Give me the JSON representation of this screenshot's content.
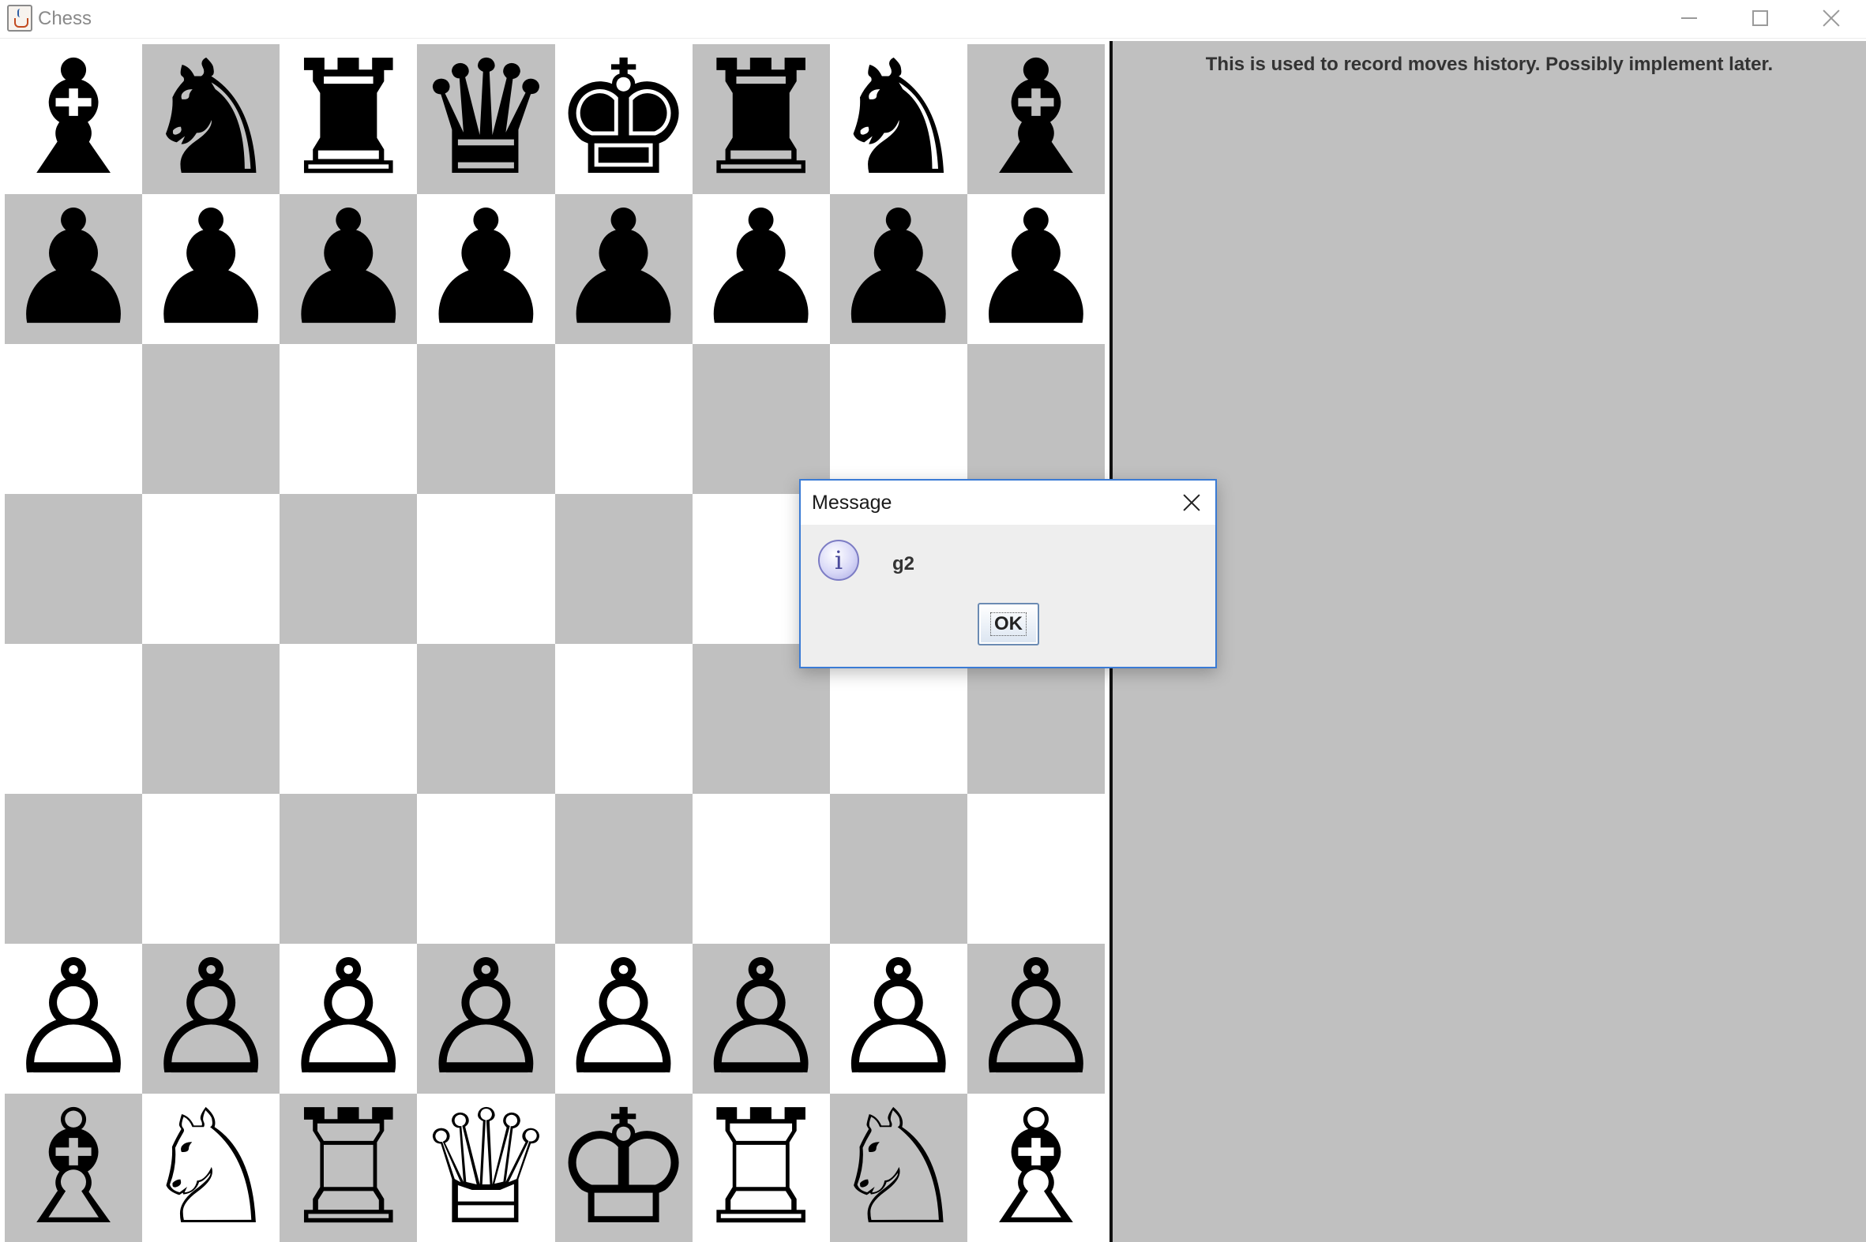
{
  "window": {
    "title": "Chess",
    "app_icon": "java-cup-icon",
    "controls": [
      "minimize-icon",
      "maximize-icon",
      "close-icon"
    ]
  },
  "history_panel": {
    "text": "This is used to record moves history. Possibly implement later.",
    "background": "#c0c0c0"
  },
  "board": {
    "light_color": "#ffffff",
    "dark_color": "#c0c0c0",
    "rows": [
      [
        "black-bishop",
        "black-knight",
        "black-rook",
        "black-queen",
        "black-king",
        "black-rook",
        "black-knight",
        "black-bishop"
      ],
      [
        "black-pawn",
        "black-pawn",
        "black-pawn",
        "black-pawn",
        "black-pawn",
        "black-pawn",
        "black-pawn",
        "black-pawn"
      ],
      [
        "",
        "",
        "",
        "",
        "",
        "",
        "",
        ""
      ],
      [
        "",
        "",
        "",
        "",
        "",
        "",
        "",
        ""
      ],
      [
        "",
        "",
        "",
        "",
        "",
        "",
        "",
        ""
      ],
      [
        "",
        "",
        "",
        "",
        "",
        "",
        "",
        ""
      ],
      [
        "white-pawn",
        "white-pawn",
        "white-pawn",
        "white-pawn",
        "white-pawn",
        "white-pawn",
        "white-pawn",
        "white-pawn"
      ],
      [
        "white-bishop",
        "white-knight",
        "white-rook",
        "white-queen",
        "white-king",
        "white-rook",
        "white-knight",
        "white-bishop"
      ]
    ]
  },
  "dialog": {
    "title": "Message",
    "icon": "info-icon",
    "message": "g2",
    "ok_label": "OK"
  }
}
